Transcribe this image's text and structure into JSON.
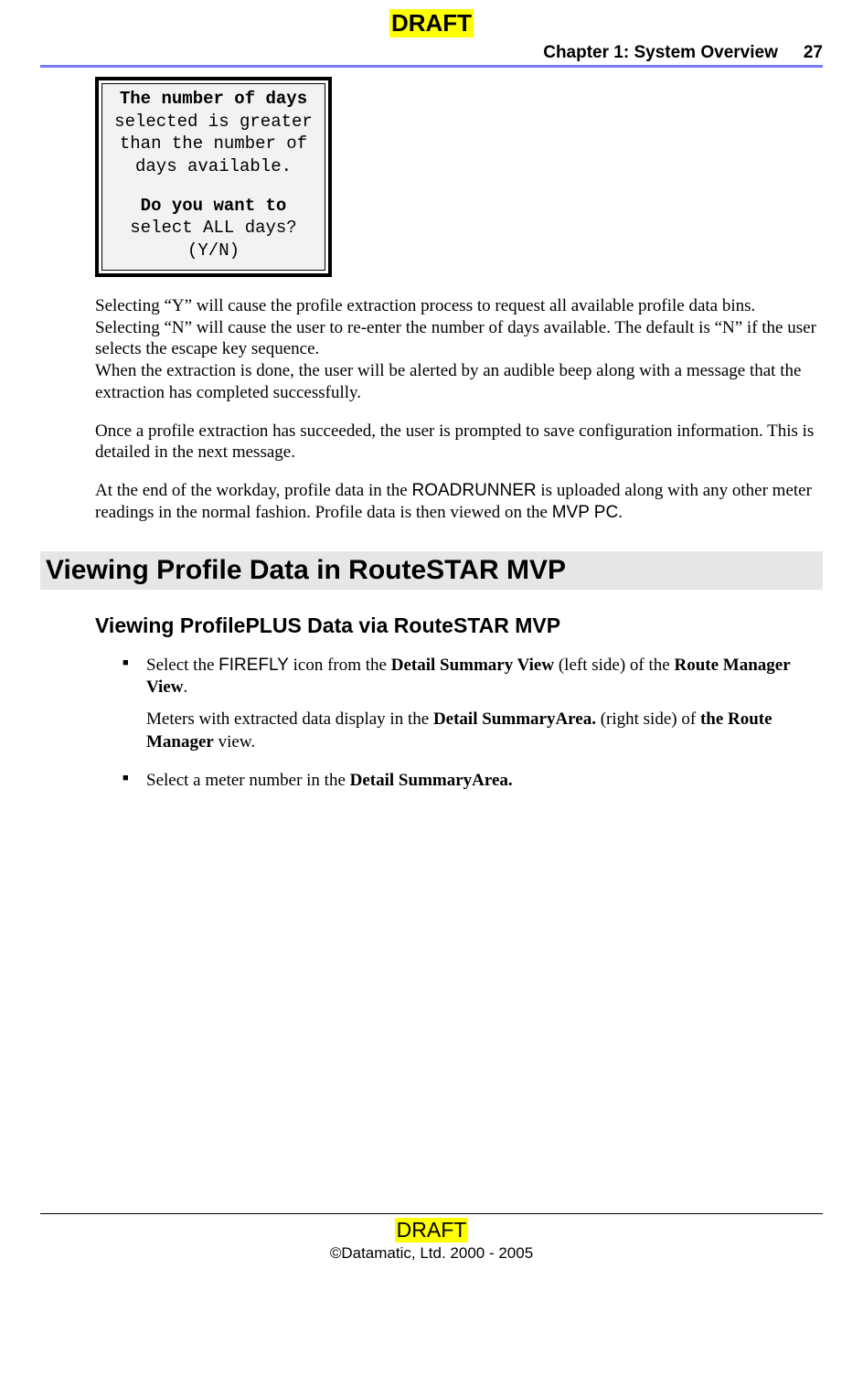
{
  "header": {
    "draft": "DRAFT",
    "chapter": "Chapter 1:  System Overview",
    "page_number": "27"
  },
  "screen": {
    "l1b": "The number of days",
    "l2": "selected is greater",
    "l3": "than the number of",
    "l4": "days available.",
    "l5b": "Do you want to",
    "l6": "select ALL days?",
    "l7": "(Y/N)"
  },
  "body": {
    "p1": "Selecting “Y” will cause the profile extraction process to request all available profile data bins.  Selecting “N” will cause the user to re-enter the number of days available.  The default is “N” if the user selects the escape key sequence.",
    "p1b": "When the extraction is done, the user will be alerted by an audible beep along with a message that the extraction has completed successfully.",
    "p2": "Once a profile extraction has succeeded, the user is prompted to save configuration information. This is detailed in the next message.",
    "p3_a": "At the end of the workday, profile data in the ",
    "p3_rr": "ROADRUNNER",
    "p3_b": " is uploaded along with any other meter readings in the normal fashion. Profile data is then viewed on the ",
    "p3_mvp": "MVP PC",
    "p3_c": "."
  },
  "h2": "Viewing Profile Data in RouteSTAR MVP",
  "h3": "Viewing ProfilePLUS Data via RouteSTAR MVP",
  "bullets": {
    "b1_a": "Select the ",
    "b1_ff": "FIREFLY",
    "b1_b": " icon from the ",
    "b1_c": "Detail Summary View",
    "b1_d": " (left side) of the ",
    "b1_e": "Route Manager View",
    "b1_f": ".",
    "b1_sub_a": "Meters with extracted data display in the ",
    "b1_sub_b": "Detail SummaryArea.",
    "b1_sub_c": " (right side) of ",
    "b1_sub_d": "the Route Manager",
    "b1_sub_e": " view.",
    "b2_a": "Select a meter number in the ",
    "b2_b": "Detail SummaryArea."
  },
  "footer": {
    "draft": "DRAFT",
    "copyright": "©Datamatic, Ltd. 2000 - 2005"
  }
}
